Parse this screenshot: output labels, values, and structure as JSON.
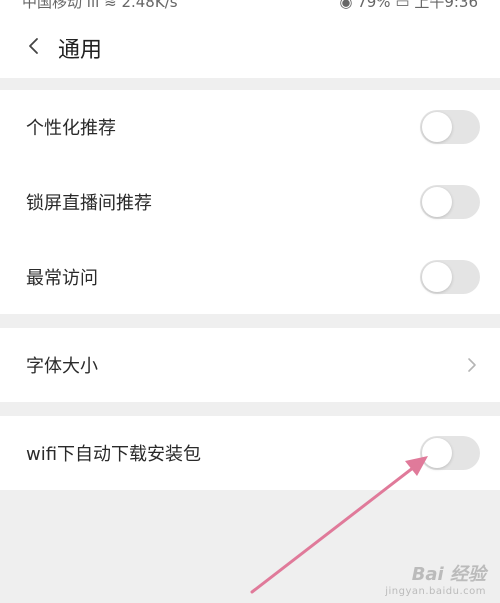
{
  "status_bar": {
    "carrier": "中国移动",
    "speed": "2.48K/s",
    "battery": "79%",
    "time": "上午9:36"
  },
  "header": {
    "title": "通用",
    "back_icon": "chevron-left-icon"
  },
  "settings": [
    {
      "label": "个性化推荐",
      "control": "toggle",
      "on": false
    },
    {
      "label": "锁屏直播间推荐",
      "control": "toggle",
      "on": false
    },
    {
      "label": "最常访问",
      "control": "toggle",
      "on": false
    },
    {
      "label": "字体大小",
      "control": "chevron"
    },
    {
      "label": "wifi下自动下载安装包",
      "control": "toggle",
      "on": false
    }
  ],
  "colors": {
    "background": "#efefef",
    "toggle_off": "#e4e4e4",
    "annotation_arrow": "#e07a9a"
  },
  "watermark": {
    "brand": "Bai  经验",
    "site": "jingyan.baidu.com"
  }
}
